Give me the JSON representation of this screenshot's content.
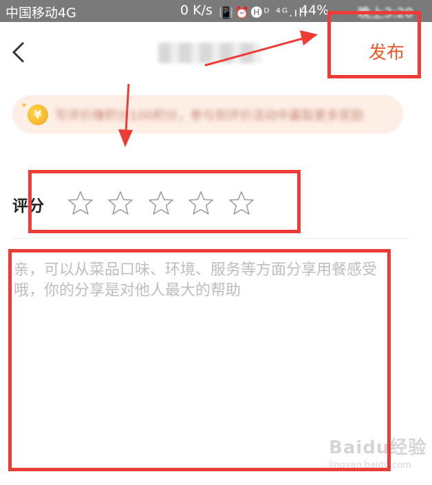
{
  "status_bar": {
    "carrier": "中国移动4G",
    "speed": "0 K/s",
    "icons": "📳⏰🅗ᴰ ⁴ᴳ.ıll",
    "battery": "44%",
    "time": "晚上3:20"
  },
  "header": {
    "back_icon": "chevron-left-icon",
    "title": "",
    "publish_label": "发布"
  },
  "promo": {
    "coin_icon": "coin-icon",
    "coin_symbol": "¥",
    "text": "写评价赚积分100积分，参与到评价活动中赢取更多奖励"
  },
  "rating": {
    "label": "评分",
    "stars_total": 5,
    "stars_selected": 0
  },
  "review": {
    "placeholder": "亲，可以从菜品口味、环境、服务等方面分享用餐感受哦，你的分享是对他人最大的帮助",
    "value": ""
  },
  "watermark": {
    "logo": "Baidu经验",
    "url": "jingyan.baidu.com"
  },
  "colors": {
    "accent": "#e85a2c",
    "annotation": "#ee3b35",
    "status_bar": "#7a7a7a"
  }
}
